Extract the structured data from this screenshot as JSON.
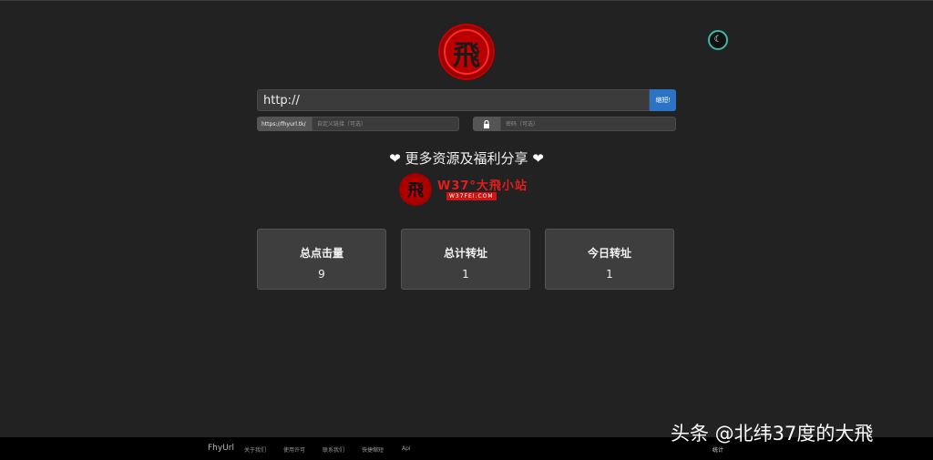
{
  "header": {
    "logo_text": "飛",
    "theme_icon": "moon-icon"
  },
  "shortener": {
    "url_placeholder": "http://",
    "submit_label": "缩短!",
    "domain_prefix": "https://fhyurl.tk/",
    "custom_link_placeholder": "自定义链接（可选）",
    "lock_icon": "lock-icon",
    "password_placeholder": "密码（可选）"
  },
  "share": {
    "text": "更多资源及福利分享",
    "heart_icon": "heart-icon"
  },
  "banner": {
    "seal_text": "飛",
    "title": "W37°大飛小站",
    "subtitle": "W37FEI.COM"
  },
  "stats": [
    {
      "label": "总点击量",
      "value": "9"
    },
    {
      "label": "总计转址",
      "value": "1"
    },
    {
      "label": "今日转址",
      "value": "1"
    }
  ],
  "footer": {
    "brand": "FhyUrl",
    "links": [
      "关于我们",
      "使用许可",
      "联系我们",
      "快捷缩短",
      "Api"
    ],
    "stats_label": "统计"
  },
  "watermark": "头条 @北纬37度的大飛",
  "colors": {
    "background": "#222222",
    "accent": "#2b73c4",
    "brand_red": "#d40000"
  }
}
